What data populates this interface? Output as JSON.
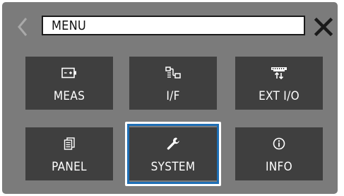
{
  "header": {
    "title": "MENU",
    "back_icon": "chevron-left-icon",
    "close_icon": "close-icon"
  },
  "tiles": [
    {
      "label": "MEAS",
      "icon": "battery-measure-icon"
    },
    {
      "label": "I/F",
      "icon": "interface-icon"
    },
    {
      "label": "EXT I/O",
      "icon": "external-io-connector-icon"
    },
    {
      "label": "PANEL",
      "icon": "panel-stack-icon"
    },
    {
      "label": "SYSTEM",
      "icon": "wrench-icon"
    },
    {
      "label": "INFO",
      "icon": "info-icon"
    }
  ],
  "selected_tile": "SYSTEM",
  "colors": {
    "screen_bg": "#7b7b7b",
    "tile_bg": "#3f3f3f",
    "selection_border": "#1f6fb5",
    "text": "#ffffff"
  }
}
